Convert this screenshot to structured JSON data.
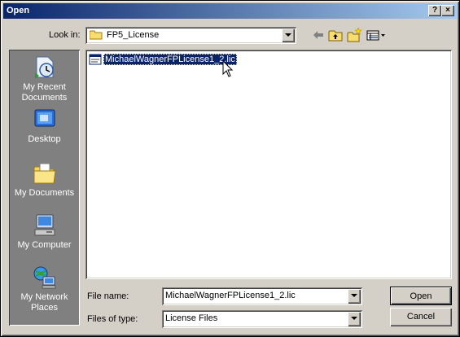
{
  "window": {
    "title": "Open",
    "help_label": "?",
    "close_label": "×"
  },
  "look_in": {
    "label": "Look in:",
    "value": "FP5_License"
  },
  "toolbar": {
    "back_icon": "back-arrow-icon",
    "up_icon": "up-folder-icon",
    "new_folder_icon": "new-folder-icon",
    "views_icon": "views-menu-icon"
  },
  "places": [
    {
      "label1": "My Recent",
      "label2": "Documents",
      "icon": "recent-documents-icon"
    },
    {
      "label1": "Desktop",
      "label2": "",
      "icon": "desktop-icon"
    },
    {
      "label1": "My Documents",
      "label2": "",
      "icon": "my-documents-icon"
    },
    {
      "label1": "My Computer",
      "label2": "",
      "icon": "my-computer-icon"
    },
    {
      "label1": "My Network",
      "label2": "Places",
      "icon": "network-places-icon"
    }
  ],
  "files": [
    {
      "name": "MichaelWagnerFPLicense1_2.lic",
      "selected": true
    }
  ],
  "file_name": {
    "label": "File name:",
    "value": "MichaelWagnerFPLicense1_2.lic"
  },
  "file_type": {
    "label": "Files of type:",
    "value": "License Files"
  },
  "buttons": {
    "open": "Open",
    "cancel": "Cancel"
  },
  "colors": {
    "title_start": "#0a246a",
    "title_end": "#a6caf0",
    "face": "#d4d0c8",
    "selection": "#0a246a"
  }
}
